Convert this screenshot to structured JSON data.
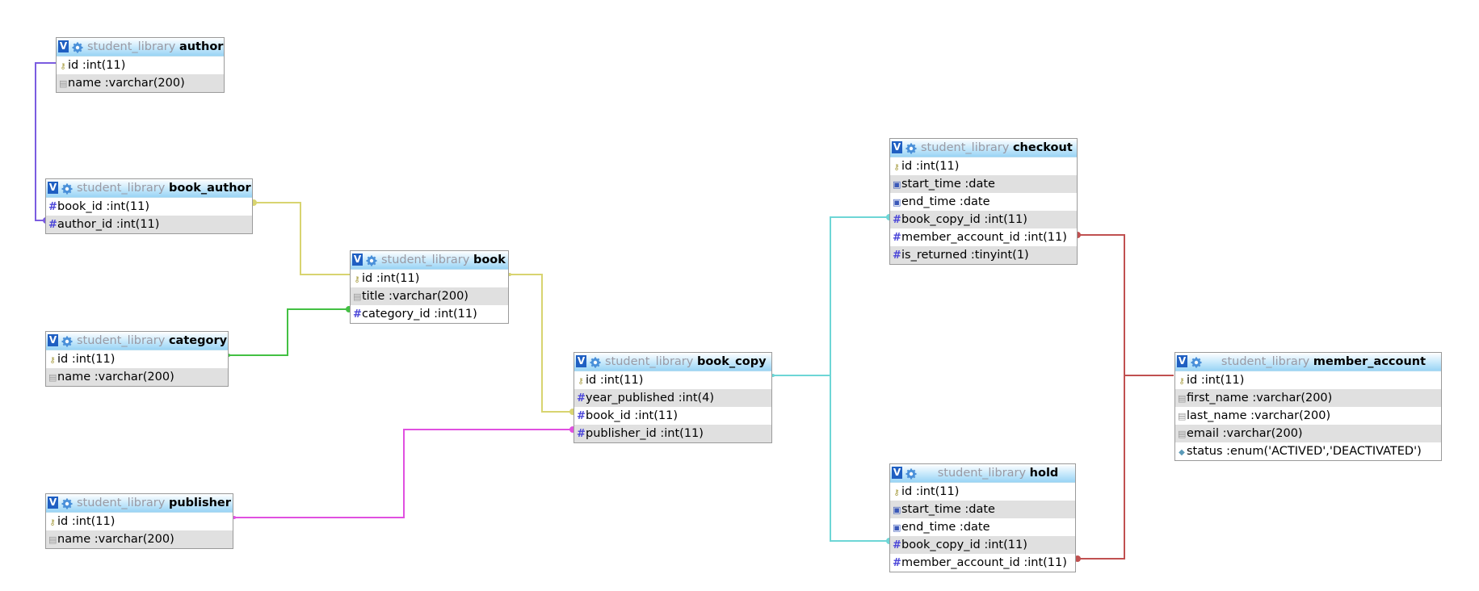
{
  "db_name": "student_library",
  "icons": {
    "view": "V",
    "settings": "gear-icon",
    "primary_key": "key-icon",
    "numeric": "#",
    "text": "text-icon",
    "date": "calendar-icon",
    "enum": "enum-icon"
  },
  "tables": {
    "author": {
      "title": "author",
      "rows": [
        {
          "text": "id :int(11)",
          "type": "key"
        },
        {
          "text": "name :varchar(200)",
          "type": "txt"
        }
      ]
    },
    "book_author": {
      "title": "book_author",
      "rows": [
        {
          "text": "book_id :int(11)",
          "type": "num"
        },
        {
          "text": "author_id :int(11)",
          "type": "num"
        }
      ]
    },
    "book": {
      "title": "book",
      "rows": [
        {
          "text": "id :int(11)",
          "type": "key"
        },
        {
          "text": "title :varchar(200)",
          "type": "txt"
        },
        {
          "text": "category_id :int(11)",
          "type": "num"
        }
      ]
    },
    "category": {
      "title": "category",
      "rows": [
        {
          "text": "id :int(11)",
          "type": "key"
        },
        {
          "text": "name :varchar(200)",
          "type": "txt"
        }
      ]
    },
    "book_copy": {
      "title": "book_copy",
      "rows": [
        {
          "text": "id :int(11)",
          "type": "key"
        },
        {
          "text": "year_published :int(4)",
          "type": "num"
        },
        {
          "text": "book_id :int(11)",
          "type": "num"
        },
        {
          "text": "publisher_id :int(11)",
          "type": "num"
        }
      ]
    },
    "publisher": {
      "title": "publisher",
      "rows": [
        {
          "text": "id :int(11)",
          "type": "key"
        },
        {
          "text": "name :varchar(200)",
          "type": "txt"
        }
      ]
    },
    "checkout": {
      "title": "checkout",
      "rows": [
        {
          "text": "id :int(11)",
          "type": "key"
        },
        {
          "text": "start_time :date",
          "type": "date"
        },
        {
          "text": "end_time :date",
          "type": "date"
        },
        {
          "text": "book_copy_id :int(11)",
          "type": "num"
        },
        {
          "text": "member_account_id :int(11)",
          "type": "num"
        },
        {
          "text": "is_returned :tinyint(1)",
          "type": "num"
        }
      ]
    },
    "hold": {
      "title": "hold",
      "rows": [
        {
          "text": "id :int(11)",
          "type": "key"
        },
        {
          "text": "start_time :date",
          "type": "date"
        },
        {
          "text": "end_time :date",
          "type": "date"
        },
        {
          "text": "book_copy_id :int(11)",
          "type": "num"
        },
        {
          "text": "member_account_id :int(11)",
          "type": "num"
        }
      ]
    },
    "member_account": {
      "title": "member_account",
      "rows": [
        {
          "text": "id :int(11)",
          "type": "key"
        },
        {
          "text": "first_name :varchar(200)",
          "type": "txt"
        },
        {
          "text": "last_name :varchar(200)",
          "type": "txt"
        },
        {
          "text": "email :varchar(200)",
          "type": "txt"
        },
        {
          "text": "status :enum('ACTIVED','DEACTIVATED')",
          "type": "enum"
        }
      ]
    }
  },
  "relation_colors": {
    "book_author_author": "#7b5ce0",
    "book_author_book": "#d8d470",
    "book_category": "#43c043",
    "book_copy_book": "#d8d470",
    "book_copy_publisher": "#e050e0",
    "copy_checkout_hold": "#6ed6d6",
    "member_checkout_hold": "#c05050"
  }
}
